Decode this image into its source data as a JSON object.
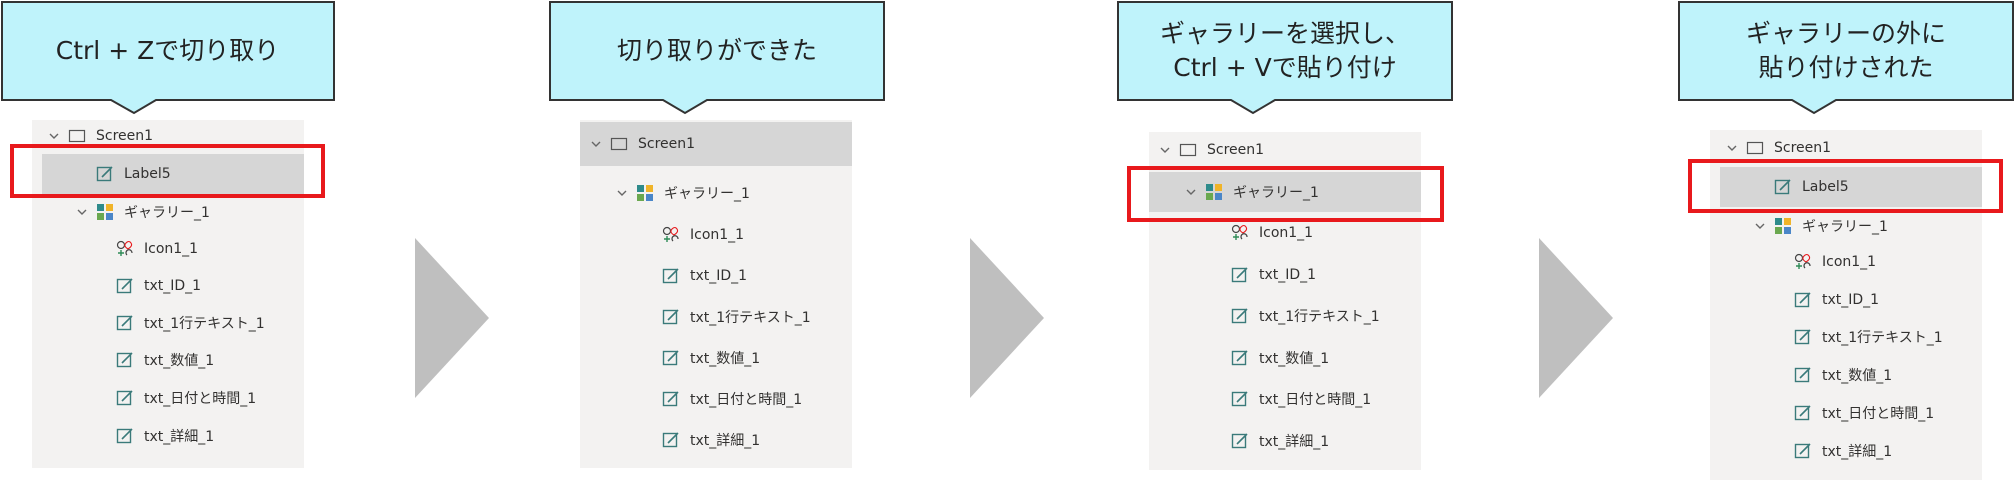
{
  "steps": [
    {
      "caption": "Ctrl + Zで切り取り",
      "tree": {
        "screen": "Screen1",
        "top_label": "Label5",
        "gallery": "ギャラリー_1",
        "children": [
          "Icon1_1",
          "txt_ID_1",
          "txt_1行テキスト_1",
          "txt_数値_1",
          "txt_日付と時間_1",
          "txt_詳細_1"
        ]
      }
    },
    {
      "caption": "切り取りができた",
      "tree": {
        "screen": "Screen1",
        "gallery": "ギャラリー_1",
        "children": [
          "Icon1_1",
          "txt_ID_1",
          "txt_1行テキスト_1",
          "txt_数値_1",
          "txt_日付と時間_1",
          "txt_詳細_1"
        ]
      }
    },
    {
      "caption": "ギャラリーを選択し、\nCtrl + Vで貼り付け",
      "tree": {
        "screen": "Screen1",
        "gallery": "ギャラリー_1",
        "children": [
          "Icon1_1",
          "txt_ID_1",
          "txt_1行テキスト_1",
          "txt_数値_1",
          "txt_日付と時間_1",
          "txt_詳細_1"
        ]
      }
    },
    {
      "caption": "ギャラリーの外に\n貼り付けされた",
      "tree": {
        "screen": "Screen1",
        "top_label": "Label5",
        "gallery": "ギャラリー_1",
        "children": [
          "Icon1_1",
          "txt_ID_1",
          "txt_1行テキスト_1",
          "txt_数値_1",
          "txt_日付と時間_1",
          "txt_詳細_1"
        ]
      }
    }
  ],
  "colors": {
    "callout_fill": "#bff3fb",
    "callout_border": "#333333",
    "highlight": "#e8191c",
    "selected_row": "#d6d6d6",
    "panel": "#f3f2f1",
    "arrow": "#bfbfbf"
  },
  "icons": {
    "screen": "screen-icon",
    "label": "edit-label-icon",
    "gallery": "gallery-icon",
    "icon_control": "icon-control-icon",
    "text_input": "edit-label-icon"
  }
}
